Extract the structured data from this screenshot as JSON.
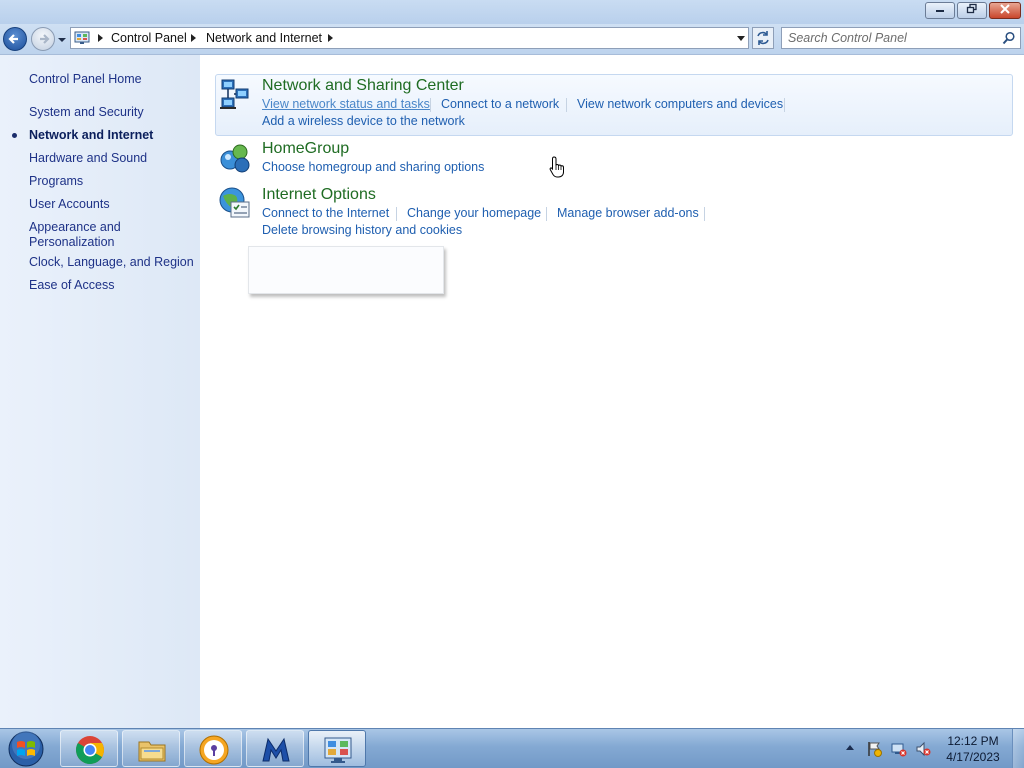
{
  "window": {
    "address": {
      "crumbs": [
        "Control Panel",
        "Network and Internet"
      ]
    },
    "search": {
      "placeholder": "Search Control Panel"
    }
  },
  "sidebar": {
    "home": "Control Panel Home",
    "items": [
      {
        "label": "System and Security"
      },
      {
        "label": "Network and Internet",
        "current": true
      },
      {
        "label": "Hardware and Sound"
      },
      {
        "label": "Programs"
      },
      {
        "label": "User Accounts"
      },
      {
        "label": "Appearance and",
        "label2": "Personalization"
      },
      {
        "label": "Clock, Language, and Region"
      },
      {
        "label": "Ease of Access"
      }
    ]
  },
  "categories": [
    {
      "title": "Network and Sharing Center",
      "icon": "network-sharing-icon",
      "tasks": [
        "View network status and tasks",
        "Connect to a network",
        "View network computers and devices",
        "Add a wireless device to the network"
      ]
    },
    {
      "title": "HomeGroup",
      "icon": "homegroup-icon",
      "tasks": [
        "Choose homegroup and sharing options"
      ]
    },
    {
      "title": "Internet Options",
      "icon": "internet-options-icon",
      "tasks": [
        "Connect to the Internet",
        "Change your homepage",
        "Manage browser add-ons",
        "Delete browsing history and cookies"
      ]
    }
  ],
  "taskbar": {
    "apps": [
      "chrome-icon",
      "file-explorer-icon",
      "password-manager-icon",
      "malwarebytes-icon",
      "control-panel-icon"
    ],
    "tray": [
      "flag-icon",
      "network-icon",
      "volume-muted-icon"
    ],
    "clock": {
      "time": "12:12 PM",
      "date": "4/17/2023"
    }
  },
  "colors": {
    "category_title": "#1f6c23",
    "task_link": "#1f5fb0",
    "sidebar_link": "#1e3287"
  }
}
